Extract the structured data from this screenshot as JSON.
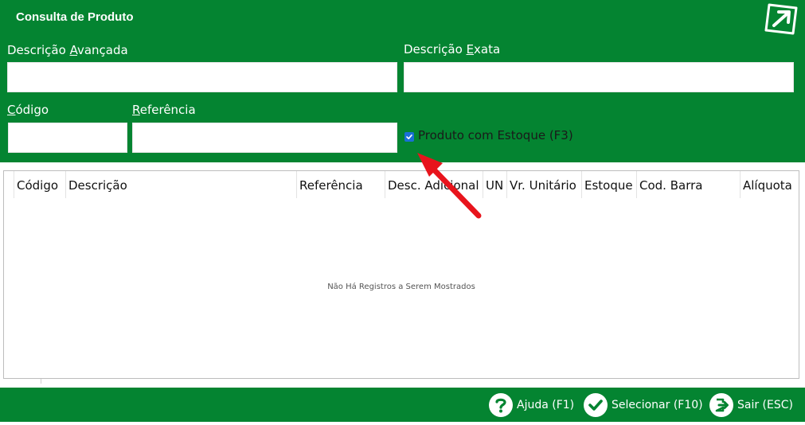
{
  "window": {
    "title": "Consulta de Produto"
  },
  "filters": {
    "adv_desc": {
      "label_pre": "Descrição ",
      "label_key": "A",
      "label_post": "vançada",
      "value": ""
    },
    "exact_desc": {
      "label_pre": "Descrição ",
      "label_key": "E",
      "label_post": "xata",
      "value": ""
    },
    "code": {
      "label_pre": "",
      "label_key": "C",
      "label_post": "ódigo",
      "value": ""
    },
    "reference": {
      "label_pre": "",
      "label_key": "R",
      "label_post": "eferência",
      "value": ""
    },
    "in_stock": {
      "label": "Produto com Estoque (F3)",
      "checked": true
    }
  },
  "grid": {
    "columns": [
      "Código",
      "Descrição",
      "Referência",
      "Desc. Adicional",
      "UN",
      "Vr. Unitário",
      "Estoque",
      "Cod. Barra",
      "Alíquota"
    ],
    "empty_message": "Não Há Registros a Serem Mostrados"
  },
  "footer": {
    "help": "Ajuda (F1)",
    "select": "Selecionar (F10)",
    "exit": "Sair (ESC)"
  },
  "colors": {
    "brand_green": "#048431",
    "checkbox_blue": "#1a6fd6",
    "arrow_red": "#e8141c"
  },
  "icons": {
    "exit_corner": "external-arrow-icon",
    "help": "question-circle-icon",
    "select": "check-circle-icon",
    "exit": "exit-door-icon"
  }
}
